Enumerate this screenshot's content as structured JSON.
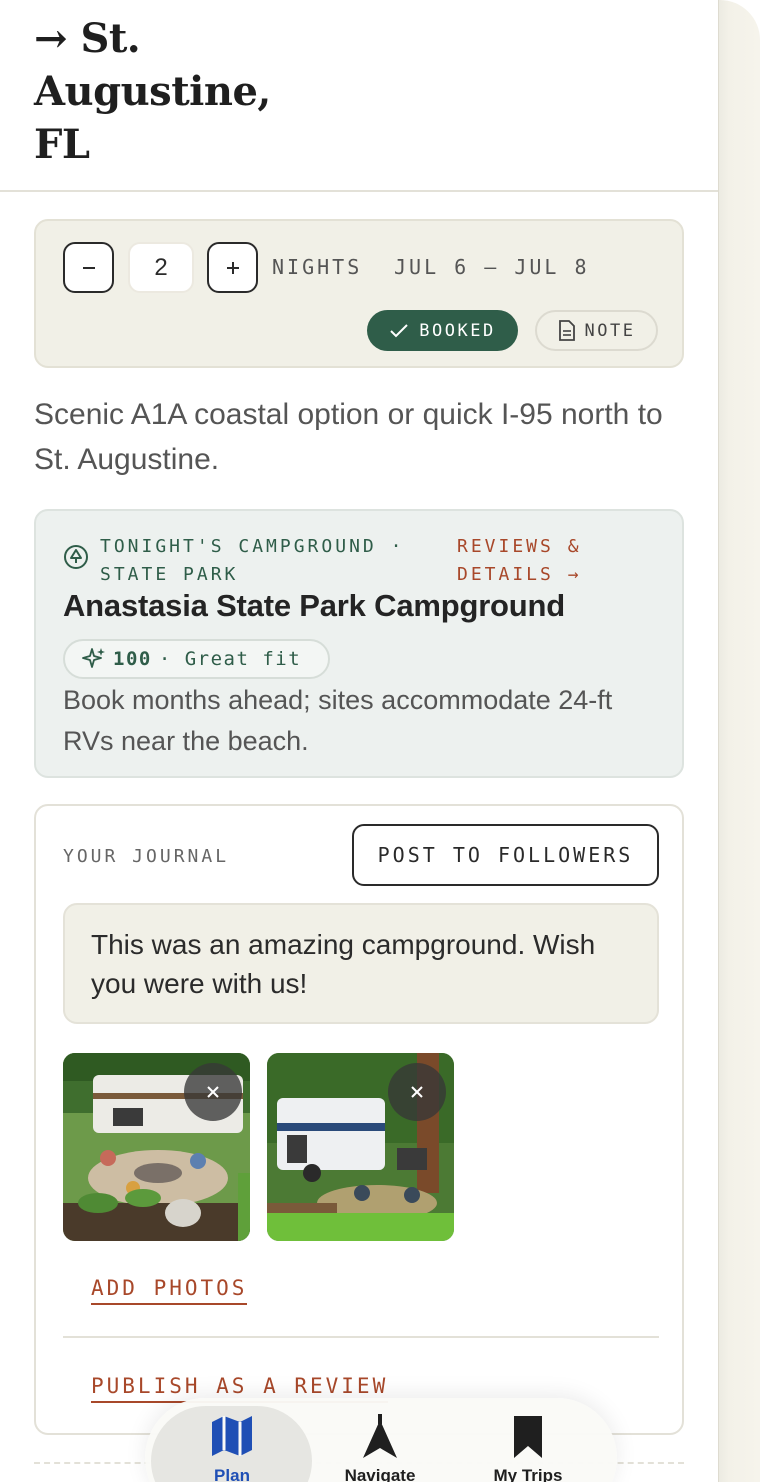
{
  "header": {
    "title_lines": [
      "→ St.",
      "Augustine,",
      "FL"
    ]
  },
  "nights": {
    "decrement_icon": "minus-icon",
    "increment_icon": "plus-icon",
    "value": "2",
    "label": "NIGHTS",
    "dates": "JUL 6 – JUL 8",
    "booked_label": "BOOKED",
    "note_label": "NOTE"
  },
  "route_description": "Scenic A1A coastal option or quick I-95 north to St. Augustine.",
  "campground": {
    "type_label": "TONIGHT'S CAMPGROUND · STATE PARK",
    "link_label": "REVIEWS & DETAILS →",
    "name": "Anastasia State Park Campground",
    "score": "100",
    "fit_label": "· Great fit",
    "description": "Book months ahead; sites accommodate 24-ft RVs near the beach."
  },
  "journal": {
    "label": "YOUR JOURNAL",
    "post_label": "POST TO FOLLOWERS",
    "entry_text": "This was an amazing campground.  Wish you were with us!",
    "add_photos_label": "ADD PHOTOS",
    "publish_label": "PUBLISH AS A REVIEW"
  },
  "tabs": [
    {
      "label": "Plan",
      "icon": "map-icon",
      "active": true
    },
    {
      "label": "Navigate",
      "icon": "navigation-arrow-icon",
      "active": false
    },
    {
      "label": "My Trips",
      "icon": "bookmark-icon",
      "active": false
    }
  ],
  "colors": {
    "accent_green": "#2f5d49",
    "link_rust": "#a8482a",
    "active_tab_blue": "#1f4fb5",
    "card_beige": "#f1f0e7",
    "card_mint": "#edf1ef"
  }
}
